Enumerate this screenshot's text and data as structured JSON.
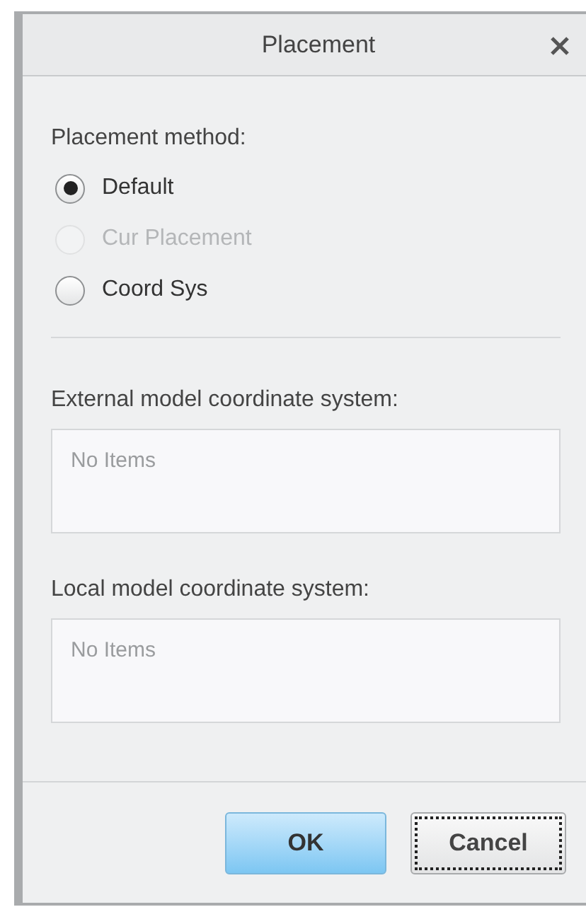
{
  "window": {
    "title": "Placement"
  },
  "placement_method": {
    "label": "Placement method:",
    "options": [
      {
        "label": "Default",
        "selected": true,
        "disabled": false
      },
      {
        "label": "Cur Placement",
        "selected": false,
        "disabled": true
      },
      {
        "label": "Coord Sys",
        "selected": false,
        "disabled": false
      }
    ]
  },
  "lists": [
    {
      "label": "External model coordinate system:",
      "empty_text": "No Items"
    },
    {
      "label": "Local model coordinate system:",
      "empty_text": "No Items"
    }
  ],
  "buttons": [
    {
      "label": "OK",
      "default": true,
      "focused": false
    },
    {
      "label": "Cancel",
      "default": false,
      "focused": true
    }
  ]
}
